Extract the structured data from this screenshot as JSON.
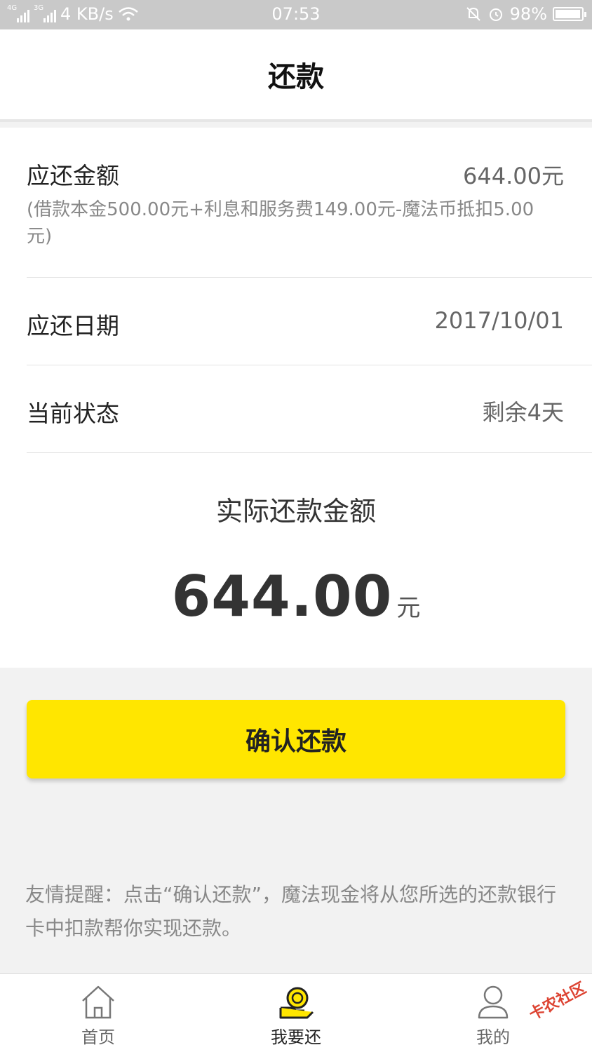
{
  "status_bar": {
    "network_1": "4G",
    "network_2": "3G",
    "speed": "4 KB/s",
    "time": "07:53",
    "battery": "98%"
  },
  "header": {
    "title": "还款"
  },
  "bill": {
    "amount_label": "应还金额",
    "amount_value": "644.00元",
    "amount_note": "(借款本金500.00元+利息和服务费149.00元-魔法币抵扣5.00元)",
    "date_label": "应还日期",
    "date_value": "2017/10/01",
    "status_label": "当前状态",
    "status_value": "剩余4天"
  },
  "actual": {
    "label": "实际还款金额",
    "amount": "644.00",
    "unit": "元"
  },
  "confirm_button": {
    "label": "确认还款"
  },
  "tip": {
    "text": "友情提醒：点击“确认还款”，魔法现金将从您所选的还款银行卡中扣款帮你实现还款。"
  },
  "tabs": [
    {
      "label": "首页",
      "icon": "home-icon"
    },
    {
      "label": "我要还",
      "icon": "repay-icon"
    },
    {
      "label": "我的",
      "icon": "user-icon"
    }
  ],
  "watermark": {
    "text": "卡农社区"
  },
  "colors": {
    "accent": "#ffe600",
    "status_bar": "#c9c9c9"
  }
}
